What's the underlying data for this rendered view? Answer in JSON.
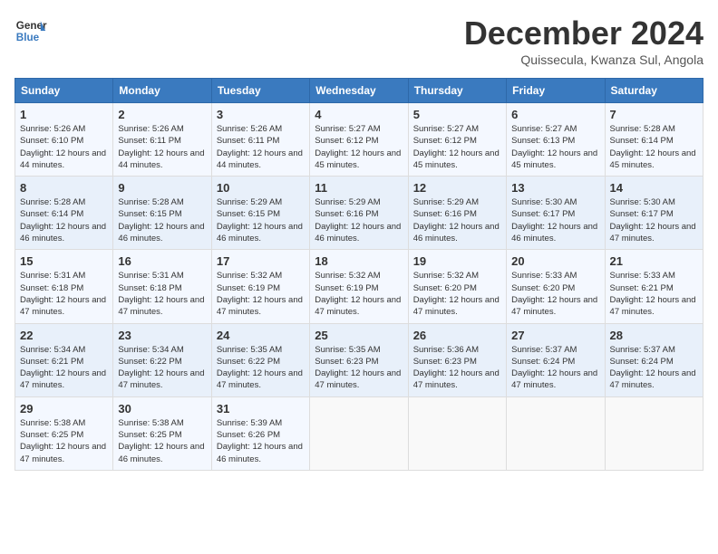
{
  "header": {
    "logo_line1": "General",
    "logo_line2": "Blue",
    "month_title": "December 2024",
    "subtitle": "Quissecula, Kwanza Sul, Angola"
  },
  "weekdays": [
    "Sunday",
    "Monday",
    "Tuesday",
    "Wednesday",
    "Thursday",
    "Friday",
    "Saturday"
  ],
  "weeks": [
    [
      {
        "day": "1",
        "sunrise": "5:26 AM",
        "sunset": "6:10 PM",
        "daylight": "12 hours and 44 minutes."
      },
      {
        "day": "2",
        "sunrise": "5:26 AM",
        "sunset": "6:11 PM",
        "daylight": "12 hours and 44 minutes."
      },
      {
        "day": "3",
        "sunrise": "5:26 AM",
        "sunset": "6:11 PM",
        "daylight": "12 hours and 44 minutes."
      },
      {
        "day": "4",
        "sunrise": "5:27 AM",
        "sunset": "6:12 PM",
        "daylight": "12 hours and 45 minutes."
      },
      {
        "day": "5",
        "sunrise": "5:27 AM",
        "sunset": "6:12 PM",
        "daylight": "12 hours and 45 minutes."
      },
      {
        "day": "6",
        "sunrise": "5:27 AM",
        "sunset": "6:13 PM",
        "daylight": "12 hours and 45 minutes."
      },
      {
        "day": "7",
        "sunrise": "5:28 AM",
        "sunset": "6:14 PM",
        "daylight": "12 hours and 45 minutes."
      }
    ],
    [
      {
        "day": "8",
        "sunrise": "5:28 AM",
        "sunset": "6:14 PM",
        "daylight": "12 hours and 46 minutes."
      },
      {
        "day": "9",
        "sunrise": "5:28 AM",
        "sunset": "6:15 PM",
        "daylight": "12 hours and 46 minutes."
      },
      {
        "day": "10",
        "sunrise": "5:29 AM",
        "sunset": "6:15 PM",
        "daylight": "12 hours and 46 minutes."
      },
      {
        "day": "11",
        "sunrise": "5:29 AM",
        "sunset": "6:16 PM",
        "daylight": "12 hours and 46 minutes."
      },
      {
        "day": "12",
        "sunrise": "5:29 AM",
        "sunset": "6:16 PM",
        "daylight": "12 hours and 46 minutes."
      },
      {
        "day": "13",
        "sunrise": "5:30 AM",
        "sunset": "6:17 PM",
        "daylight": "12 hours and 46 minutes."
      },
      {
        "day": "14",
        "sunrise": "5:30 AM",
        "sunset": "6:17 PM",
        "daylight": "12 hours and 47 minutes."
      }
    ],
    [
      {
        "day": "15",
        "sunrise": "5:31 AM",
        "sunset": "6:18 PM",
        "daylight": "12 hours and 47 minutes."
      },
      {
        "day": "16",
        "sunrise": "5:31 AM",
        "sunset": "6:18 PM",
        "daylight": "12 hours and 47 minutes."
      },
      {
        "day": "17",
        "sunrise": "5:32 AM",
        "sunset": "6:19 PM",
        "daylight": "12 hours and 47 minutes."
      },
      {
        "day": "18",
        "sunrise": "5:32 AM",
        "sunset": "6:19 PM",
        "daylight": "12 hours and 47 minutes."
      },
      {
        "day": "19",
        "sunrise": "5:32 AM",
        "sunset": "6:20 PM",
        "daylight": "12 hours and 47 minutes."
      },
      {
        "day": "20",
        "sunrise": "5:33 AM",
        "sunset": "6:20 PM",
        "daylight": "12 hours and 47 minutes."
      },
      {
        "day": "21",
        "sunrise": "5:33 AM",
        "sunset": "6:21 PM",
        "daylight": "12 hours and 47 minutes."
      }
    ],
    [
      {
        "day": "22",
        "sunrise": "5:34 AM",
        "sunset": "6:21 PM",
        "daylight": "12 hours and 47 minutes."
      },
      {
        "day": "23",
        "sunrise": "5:34 AM",
        "sunset": "6:22 PM",
        "daylight": "12 hours and 47 minutes."
      },
      {
        "day": "24",
        "sunrise": "5:35 AM",
        "sunset": "6:22 PM",
        "daylight": "12 hours and 47 minutes."
      },
      {
        "day": "25",
        "sunrise": "5:35 AM",
        "sunset": "6:23 PM",
        "daylight": "12 hours and 47 minutes."
      },
      {
        "day": "26",
        "sunrise": "5:36 AM",
        "sunset": "6:23 PM",
        "daylight": "12 hours and 47 minutes."
      },
      {
        "day": "27",
        "sunrise": "5:37 AM",
        "sunset": "6:24 PM",
        "daylight": "12 hours and 47 minutes."
      },
      {
        "day": "28",
        "sunrise": "5:37 AM",
        "sunset": "6:24 PM",
        "daylight": "12 hours and 47 minutes."
      }
    ],
    [
      {
        "day": "29",
        "sunrise": "5:38 AM",
        "sunset": "6:25 PM",
        "daylight": "12 hours and 47 minutes."
      },
      {
        "day": "30",
        "sunrise": "5:38 AM",
        "sunset": "6:25 PM",
        "daylight": "12 hours and 46 minutes."
      },
      {
        "day": "31",
        "sunrise": "5:39 AM",
        "sunset": "6:26 PM",
        "daylight": "12 hours and 46 minutes."
      },
      null,
      null,
      null,
      null
    ]
  ]
}
